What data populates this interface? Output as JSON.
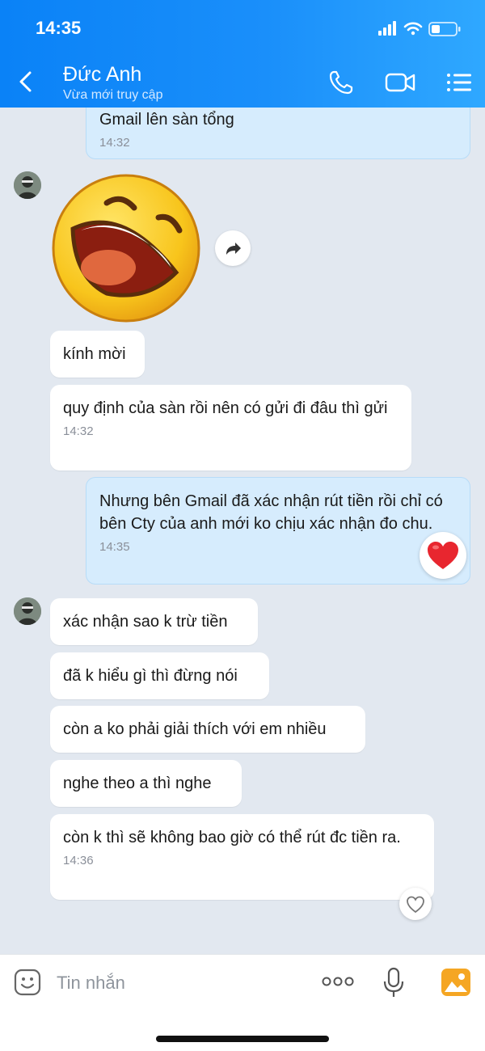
{
  "status_bar": {
    "time": "14:35"
  },
  "header": {
    "contact_name": "Đức Anh",
    "presence": "Vừa mới truy cập"
  },
  "messages": [
    {
      "text": "Gmail lên sàn tổng",
      "time": "14:32"
    },
    {
      "sticker": "laughing-face-sticker"
    },
    {
      "text": "kính mời"
    },
    {
      "text": "quy định của sàn rồi nên có gửi đi đâu thì gửi",
      "time": "14:32"
    },
    {
      "text": "Nhưng bên Gmail đã xác nhận rút tiền rồi chỉ có bên Cty của anh mới ko chịu xác nhận đo chu.",
      "time": "14:35",
      "reaction": "heart"
    },
    {
      "text": "xác nhận sao k trừ tiền"
    },
    {
      "text": "đã k hiểu gì thì đừng nói"
    },
    {
      "text": "còn a ko phải giải thích với em nhiều"
    },
    {
      "text": "nghe theo a thì nghe"
    },
    {
      "text": "còn k thì sẽ không bao giờ có thể rút đc tiền ra.",
      "time": "14:36"
    }
  ],
  "composer": {
    "placeholder": "Tin nhắn"
  },
  "colors": {
    "header_blue": "#0a82f7",
    "outgoing_bubble": "#d6ecfd",
    "chat_bg": "#e2e8f0",
    "image_button": "#f5a623"
  }
}
